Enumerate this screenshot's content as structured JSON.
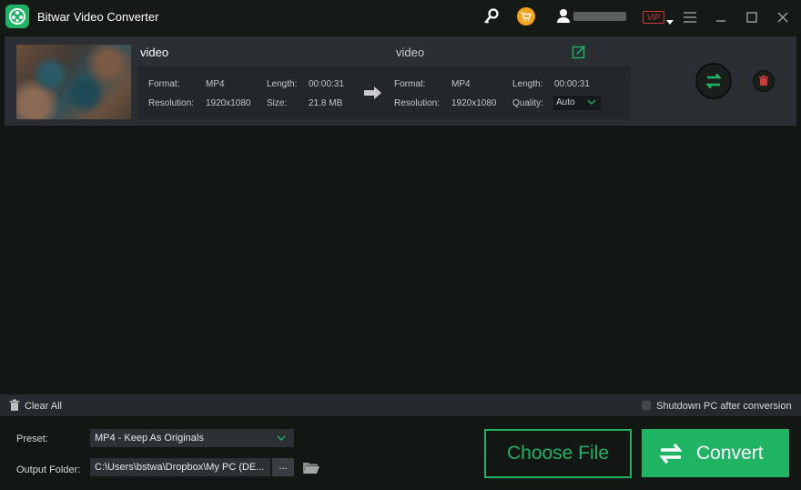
{
  "window": {
    "title": "Bitwar Video Converter",
    "vip_badge": "VIP"
  },
  "file": {
    "source_name": "video",
    "output_name": "video",
    "source": {
      "format_label": "Format:",
      "format": "MP4",
      "length_label": "Length:",
      "length": "00:00:31",
      "resolution_label": "Resolution:",
      "resolution": "1920x1080",
      "size_label": "Size:",
      "size": "21.8 MB"
    },
    "output": {
      "format_label": "Format:",
      "format": "MP4",
      "length_label": "Length:",
      "length": "00:00:31",
      "resolution_label": "Resolution:",
      "resolution": "1920x1080",
      "quality_label": "Quality:",
      "quality": "Auto"
    }
  },
  "bottom": {
    "clear_all": "Clear All",
    "shutdown_label": "Shutdown PC after conversion",
    "preset_label": "Preset:",
    "preset_value": "MP4 - Keep As Originals",
    "output_folder_label": "Output Folder:",
    "output_folder_value": "C:\\Users\\bstwa\\Dropbox\\My PC (DE...",
    "browse_label": "...",
    "choose_file": "Choose File",
    "convert": "Convert"
  },
  "colors": {
    "accent": "#1fb364",
    "danger": "#d23a3a",
    "background": "#121714"
  },
  "icons": [
    "app-logo-icon",
    "key-icon",
    "cart-icon",
    "user-icon",
    "menu-icon",
    "minimize-icon",
    "maximize-icon",
    "close-icon",
    "edit-icon",
    "arrow-right-icon",
    "convert-arrows-icon",
    "trash-icon",
    "folder-icon"
  ]
}
